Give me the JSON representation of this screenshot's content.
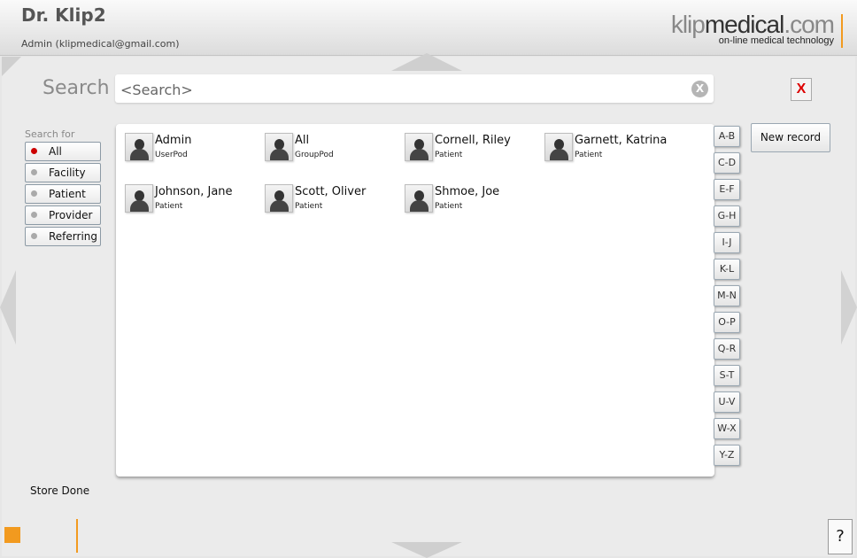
{
  "header": {
    "title": "Dr. Klip2",
    "user": "Admin (klipmedical@gmail.com)",
    "logo_light": "klip",
    "logo_bold": "medical",
    "logo_suffix": ".com",
    "logo_tagline": "on-line medical technology"
  },
  "search": {
    "label": "Search",
    "placeholder": "<Search>",
    "clear_label": "X",
    "close_label": "X"
  },
  "filters": {
    "label": "Search for",
    "items": [
      {
        "label": "All",
        "active": true
      },
      {
        "label": "Facility",
        "active": false
      },
      {
        "label": "Patient",
        "active": false
      },
      {
        "label": "Provider",
        "active": false
      },
      {
        "label": "Referring",
        "active": false
      }
    ]
  },
  "records": [
    {
      "name": "Admin",
      "type": "UserPod"
    },
    {
      "name": "All",
      "type": "GroupPod"
    },
    {
      "name": "Cornell, Riley",
      "type": "Patient"
    },
    {
      "name": "Garnett, Katrina",
      "type": "Patient"
    },
    {
      "name": "Johnson, Jane",
      "type": "Patient"
    },
    {
      "name": "Scott, Oliver",
      "type": "Patient"
    },
    {
      "name": "Shmoe, Joe",
      "type": "Patient"
    }
  ],
  "alphabet": [
    "A-B",
    "C-D",
    "E-F",
    "G-H",
    "I-J",
    "K-L",
    "M-N",
    "O-P",
    "Q-R",
    "S-T",
    "U-V",
    "W-X",
    "Y-Z"
  ],
  "actions": {
    "new_record": "New record",
    "help": "?"
  },
  "status": "Store Done",
  "colors": {
    "accent": "#f29a1f",
    "close": "#dd0000"
  }
}
